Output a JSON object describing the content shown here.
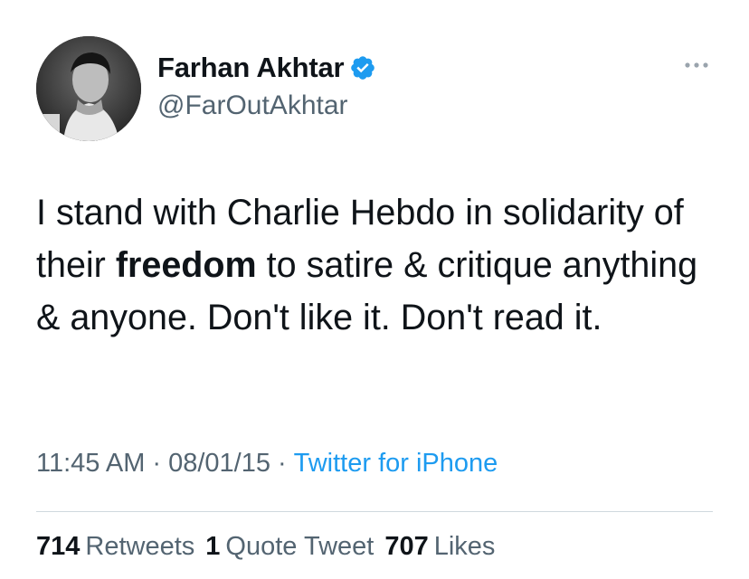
{
  "author": {
    "display_name": "Farhan Akhtar",
    "handle": "@FarOutAkhtar",
    "verified": true,
    "verified_icon": "verified-badge-icon",
    "verified_color": "#1d9bf0"
  },
  "tweet": {
    "text_before_bold": "I stand with Charlie Hebdo in solidarity of their ",
    "text_bold": "freedom",
    "text_after_bold": " to satire & critique anything & anyone. Don't like it. Don't read it."
  },
  "meta": {
    "time": "11:45 AM",
    "separator": "·",
    "date": "08/01/15",
    "source": "Twitter for iPhone"
  },
  "stats": {
    "retweets_count": "714",
    "retweets_label": "Retweets",
    "quotes_count": "1",
    "quotes_label": "Quote Tweet",
    "likes_count": "707",
    "likes_label": "Likes"
  },
  "colors": {
    "text_primary": "#0f1419",
    "text_secondary": "#536471",
    "link": "#1d9bf0",
    "divider": "#cfd9de"
  }
}
